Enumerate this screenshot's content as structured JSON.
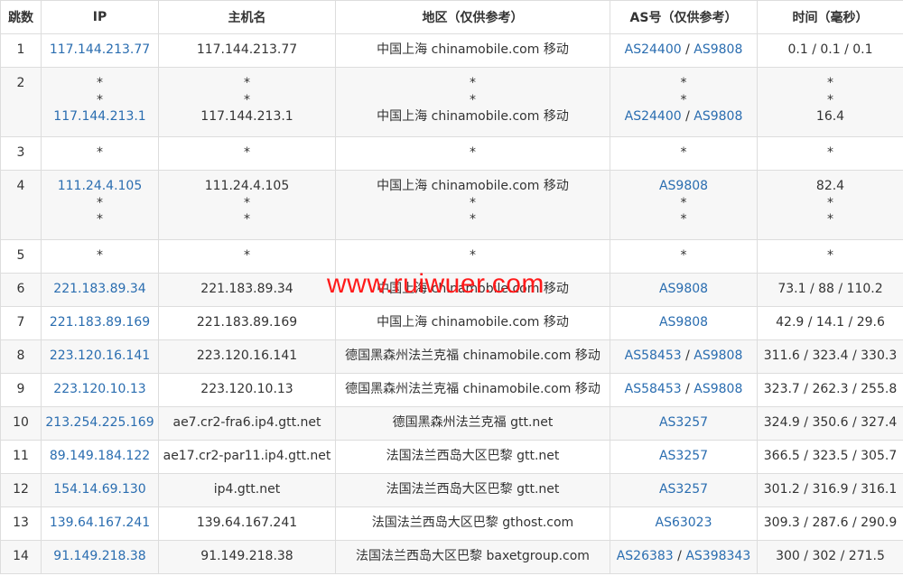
{
  "headers": [
    "跳数",
    "IP",
    "主机名",
    "地区（仅供参考）",
    "AS号（仅供参考）",
    "时间（毫秒）"
  ],
  "watermark": "www.ruiwuer.com",
  "rows": [
    {
      "hop": "1",
      "ip": [
        "117.144.213.77"
      ],
      "host": [
        "117.144.213.77"
      ],
      "region": [
        "中国上海 chinamobile.com 移动"
      ],
      "as": [
        [
          "AS24400",
          "AS9808"
        ]
      ],
      "time": [
        "0.1 / 0.1 / 0.1"
      ]
    },
    {
      "hop": "2",
      "ip": [
        "*",
        "*",
        "117.144.213.1"
      ],
      "host": [
        "*",
        "*",
        "117.144.213.1"
      ],
      "region": [
        "*",
        "*",
        "中国上海 chinamobile.com 移动"
      ],
      "as": [
        [
          "*"
        ],
        [
          "*"
        ],
        [
          "AS24400",
          "AS9808"
        ]
      ],
      "time": [
        "*",
        "*",
        "16.4"
      ]
    },
    {
      "hop": "3",
      "ip": [
        "*"
      ],
      "host": [
        "*"
      ],
      "region": [
        "*"
      ],
      "as": [
        [
          "*"
        ]
      ],
      "time": [
        "*"
      ]
    },
    {
      "hop": "4",
      "ip": [
        "111.24.4.105",
        "*",
        "*"
      ],
      "host": [
        "111.24.4.105",
        "*",
        "*"
      ],
      "region": [
        "中国上海 chinamobile.com 移动",
        "*",
        "*"
      ],
      "as": [
        [
          "AS9808"
        ],
        [
          "*"
        ],
        [
          "*"
        ]
      ],
      "time": [
        "82.4",
        "*",
        "*"
      ]
    },
    {
      "hop": "5",
      "ip": [
        "*"
      ],
      "host": [
        "*"
      ],
      "region": [
        "*"
      ],
      "as": [
        [
          "*"
        ]
      ],
      "time": [
        "*"
      ]
    },
    {
      "hop": "6",
      "ip": [
        "221.183.89.34"
      ],
      "host": [
        "221.183.89.34"
      ],
      "region": [
        "中国上海 chinamobile.com 移动"
      ],
      "as": [
        [
          "AS9808"
        ]
      ],
      "time": [
        "73.1 / 88 / 110.2"
      ]
    },
    {
      "hop": "7",
      "ip": [
        "221.183.89.169"
      ],
      "host": [
        "221.183.89.169"
      ],
      "region": [
        "中国上海 chinamobile.com 移动"
      ],
      "as": [
        [
          "AS9808"
        ]
      ],
      "time": [
        "42.9 / 14.1 / 29.6"
      ]
    },
    {
      "hop": "8",
      "ip": [
        "223.120.16.141"
      ],
      "host": [
        "223.120.16.141"
      ],
      "region": [
        "德国黑森州法兰克福 chinamobile.com 移动"
      ],
      "as": [
        [
          "AS58453",
          "AS9808"
        ]
      ],
      "time": [
        "311.6 / 323.4 / 330.3"
      ]
    },
    {
      "hop": "9",
      "ip": [
        "223.120.10.13"
      ],
      "host": [
        "223.120.10.13"
      ],
      "region": [
        "德国黑森州法兰克福 chinamobile.com 移动"
      ],
      "as": [
        [
          "AS58453",
          "AS9808"
        ]
      ],
      "time": [
        "323.7 / 262.3 / 255.8"
      ]
    },
    {
      "hop": "10",
      "ip": [
        "213.254.225.169"
      ],
      "host": [
        "ae7.cr2-fra6.ip4.gtt.net"
      ],
      "region": [
        "德国黑森州法兰克福 gtt.net"
      ],
      "as": [
        [
          "AS3257"
        ]
      ],
      "time": [
        "324.9 / 350.6 / 327.4"
      ]
    },
    {
      "hop": "11",
      "ip": [
        "89.149.184.122"
      ],
      "host": [
        "ae17.cr2-par11.ip4.gtt.net"
      ],
      "region": [
        "法国法兰西岛大区巴黎 gtt.net"
      ],
      "as": [
        [
          "AS3257"
        ]
      ],
      "time": [
        "366.5 / 323.5 / 305.7"
      ]
    },
    {
      "hop": "12",
      "ip": [
        "154.14.69.130"
      ],
      "host": [
        "ip4.gtt.net"
      ],
      "region": [
        "法国法兰西岛大区巴黎 gtt.net"
      ],
      "as": [
        [
          "AS3257"
        ]
      ],
      "time": [
        "301.2 / 316.9 / 316.1"
      ]
    },
    {
      "hop": "13",
      "ip": [
        "139.64.167.241"
      ],
      "host": [
        "139.64.167.241"
      ],
      "region": [
        "法国法兰西岛大区巴黎 gthost.com"
      ],
      "as": [
        [
          "AS63023"
        ]
      ],
      "time": [
        "309.3 / 287.6 / 290.9"
      ]
    },
    {
      "hop": "14",
      "ip": [
        "91.149.218.38"
      ],
      "host": [
        "91.149.218.38"
      ],
      "region": [
        "法国法兰西岛大区巴黎 baxetgroup.com"
      ],
      "as": [
        [
          "AS26383",
          "AS398343"
        ]
      ],
      "time": [
        "300 / 302 / 271.5"
      ]
    }
  ]
}
